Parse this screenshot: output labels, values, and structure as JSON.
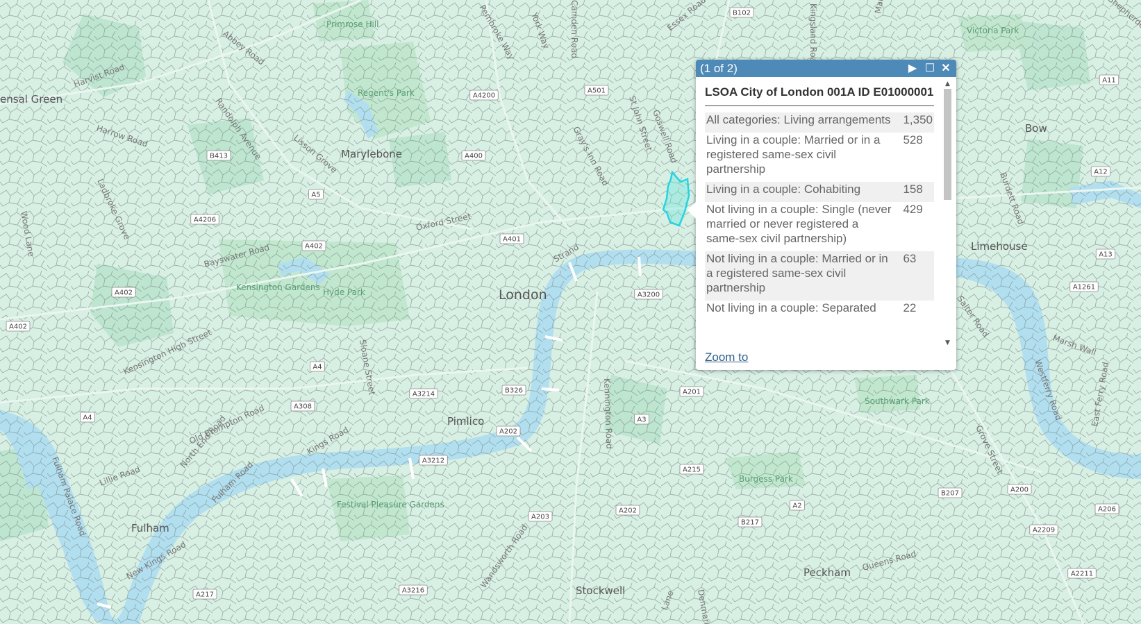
{
  "map": {
    "places": [
      {
        "name": "ensal Green"
      },
      {
        "name": "Marylebone"
      },
      {
        "name": "London"
      },
      {
        "name": "Pimlico"
      },
      {
        "name": "Fulham"
      },
      {
        "name": "Stockwell"
      },
      {
        "name": "Peckham"
      },
      {
        "name": "Limehouse"
      },
      {
        "name": "Bow"
      }
    ],
    "parks": [
      {
        "name": "Primrose Hill"
      },
      {
        "name": "Regent's Park"
      },
      {
        "name": "Hyde Park"
      },
      {
        "name": "Kensington Gardens"
      },
      {
        "name": "Festival Pleasure Gardens"
      },
      {
        "name": "Burgess Park"
      },
      {
        "name": "Southwark Park"
      },
      {
        "name": "Victoria Park"
      }
    ],
    "roads": [
      {
        "name": "Harvist Road"
      },
      {
        "name": "Harrow Road"
      },
      {
        "name": "Abbey Road"
      },
      {
        "name": "Randolph Avenue"
      },
      {
        "name": "Lisson Grove"
      },
      {
        "name": "Ladbroke Grove"
      },
      {
        "name": "Wood Lane"
      },
      {
        "name": "Bayswater Road"
      },
      {
        "name": "Oxford Street"
      },
      {
        "name": "Strand"
      },
      {
        "name": "Gray's Inn Road"
      },
      {
        "name": "St John Street"
      },
      {
        "name": "Goswell Road"
      },
      {
        "name": "Essex Road"
      },
      {
        "name": "Kensington High Street"
      },
      {
        "name": "Sloane Street"
      },
      {
        "name": "Old Brompton Road"
      },
      {
        "name": "Kings Road"
      },
      {
        "name": "Fulham Road"
      },
      {
        "name": "Lillie Road"
      },
      {
        "name": "North End Road"
      },
      {
        "name": "Fulham Palace Road"
      },
      {
        "name": "New Kings Road"
      },
      {
        "name": "Kennington Road"
      },
      {
        "name": "Wandsworth Road"
      },
      {
        "name": "Queens Road"
      },
      {
        "name": "Grove Street"
      },
      {
        "name": "Burdett Road"
      },
      {
        "name": "Westferry Road"
      },
      {
        "name": "East Ferry Road"
      },
      {
        "name": "Marsh Wall"
      },
      {
        "name": "Salter Road"
      },
      {
        "name": "York Way"
      },
      {
        "name": "Pembroke Way"
      },
      {
        "name": "Shepherdess Walk"
      },
      {
        "name": "Kingsland Road"
      },
      {
        "name": "Mare Street"
      },
      {
        "name": "Camden Road"
      },
      {
        "name": "Denmark Hill"
      },
      {
        "name": "Lane"
      }
    ],
    "shields": [
      {
        "label": "B102"
      },
      {
        "label": "A4200"
      },
      {
        "label": "A501"
      },
      {
        "label": "B413"
      },
      {
        "label": "A400"
      },
      {
        "label": "A5"
      },
      {
        "label": "A4206"
      },
      {
        "label": "A402"
      },
      {
        "label": "A401"
      },
      {
        "label": "A402"
      },
      {
        "label": "A402"
      },
      {
        "label": "A4"
      },
      {
        "label": "A308"
      },
      {
        "label": "A3214"
      },
      {
        "label": "B326"
      },
      {
        "label": "A202"
      },
      {
        "label": "A3212"
      },
      {
        "label": "A3200"
      },
      {
        "label": "A201"
      },
      {
        "label": "A3"
      },
      {
        "label": "A215"
      },
      {
        "label": "A202"
      },
      {
        "label": "A203"
      },
      {
        "label": "A3216"
      },
      {
        "label": "A217"
      },
      {
        "label": "B217"
      },
      {
        "label": "A2"
      },
      {
        "label": "B207"
      },
      {
        "label": "A200"
      },
      {
        "label": "A206"
      },
      {
        "label": "A2209"
      },
      {
        "label": "A2211"
      },
      {
        "label": "A11"
      },
      {
        "label": "A12"
      },
      {
        "label": "A13"
      },
      {
        "label": "A1261"
      },
      {
        "label": "A4"
      }
    ]
  },
  "popup": {
    "header": "(1 of 2)",
    "title": "LSOA City of London 001A ID E01000001",
    "rows": [
      {
        "field": "All categories: Living arrangements",
        "value": "1,350"
      },
      {
        "field": "Living in a couple: Married or in a registered same-sex civil partnership",
        "value": "528"
      },
      {
        "field": "Living in a couple: Cohabiting",
        "value": "158"
      },
      {
        "field": "Not living in a couple: Single (never married or never registered a same-sex civil partnership)",
        "value": "429"
      },
      {
        "field": "Not living in a couple: Married or in a registered same-sex civil partnership",
        "value": "63"
      },
      {
        "field": "Not living in a couple: Separated",
        "value": "22"
      }
    ],
    "zoom_label": "Zoom to",
    "icons": {
      "next": "play-icon",
      "maximize": "maximize-icon",
      "close": "close-icon"
    }
  },
  "colors": {
    "water": "#b2dff0",
    "land": "#d9f0e6",
    "park": "#bfe6cc",
    "popup_header": "#4e8ab8",
    "highlight": "#27d3e0"
  }
}
